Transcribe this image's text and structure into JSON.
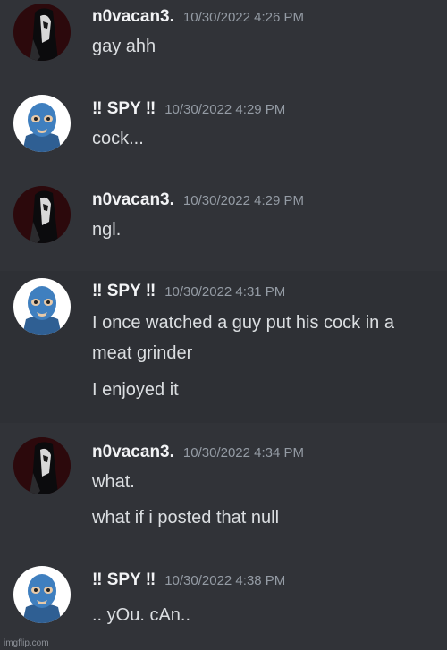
{
  "messages": [
    {
      "author": "n0vacan3.",
      "avatar": "dark-masked-figure-avatar",
      "timestamp": "10/30/2022 4:26 PM",
      "lines": [
        "gay ahh"
      ]
    },
    {
      "author": "‼ SPY ‼",
      "avatar": "blue-spy-avatar",
      "timestamp": "10/30/2022 4:29 PM",
      "lines": [
        "cock..."
      ]
    },
    {
      "author": "n0vacan3.",
      "avatar": "dark-masked-figure-avatar",
      "timestamp": "10/30/2022 4:29 PM",
      "lines": [
        "ngl."
      ]
    },
    {
      "author": "‼ SPY ‼",
      "avatar": "blue-spy-avatar",
      "timestamp": "10/30/2022 4:31 PM",
      "lines": [
        "I once watched a guy put his cock in a",
        "meat grinder",
        "I enjoyed it"
      ]
    },
    {
      "author": "n0vacan3.",
      "avatar": "dark-masked-figure-avatar",
      "timestamp": "10/30/2022 4:34 PM",
      "lines": [
        "what.",
        "what if i posted that null"
      ]
    },
    {
      "author": "‼ SPY ‼",
      "avatar": "blue-spy-avatar",
      "timestamp": "10/30/2022 4:38 PM",
      "lines": [
        ".. yOu. cAn.."
      ]
    }
  ],
  "watermark": "imgflip.com",
  "colors": {
    "background": "#313338",
    "username": "#f2f3f5",
    "timestamp": "#949ba4",
    "message_text": "#dbdee1",
    "spy_blue": "#3f7fbf"
  }
}
